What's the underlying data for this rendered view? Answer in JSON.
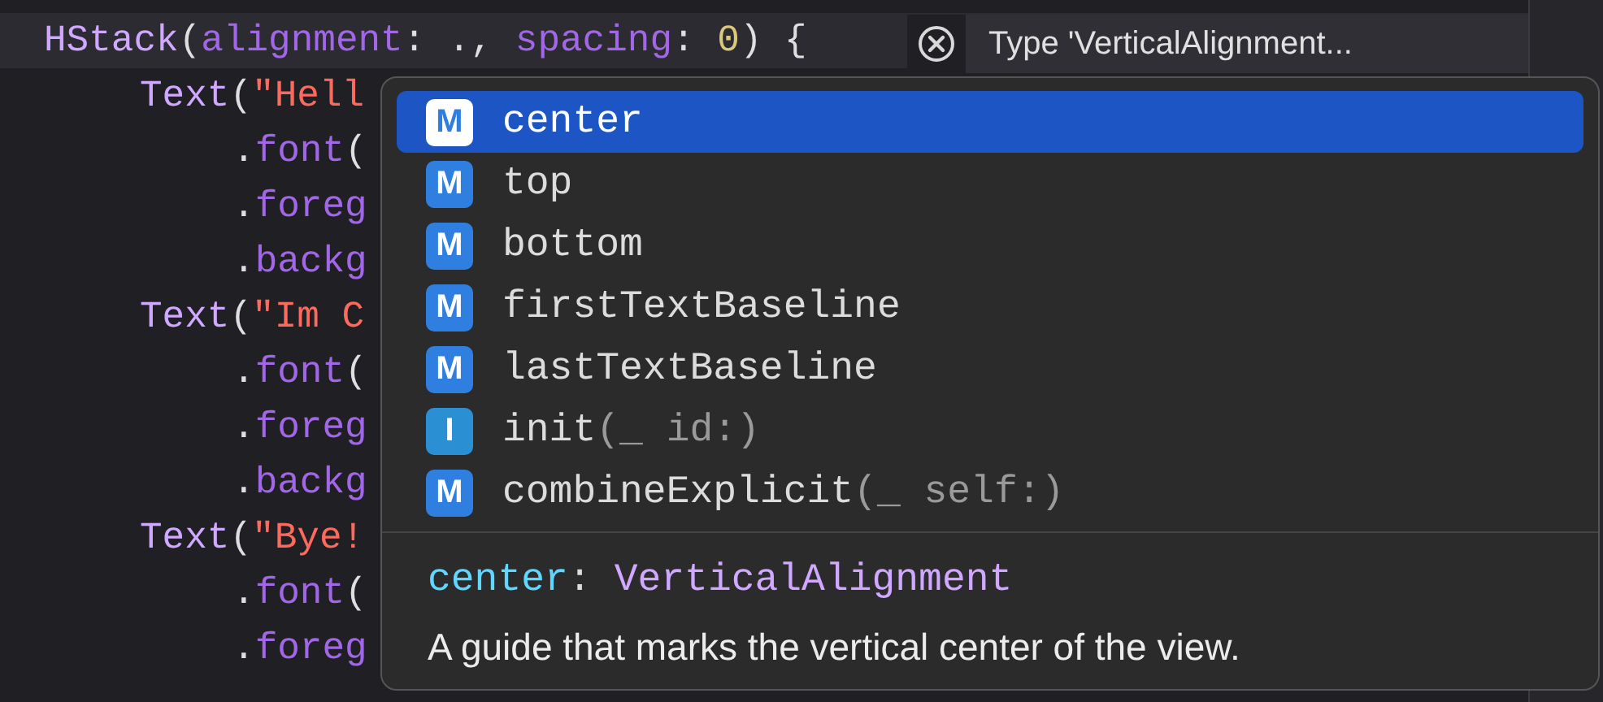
{
  "code_lines": [
    {
      "kind": "stack",
      "current": true,
      "tokens": [
        {
          "text": "HStack",
          "kind": "type"
        },
        {
          "text": "(",
          "kind": "plain"
        },
        {
          "text": "alignment",
          "kind": "member"
        },
        {
          "text": ": ., ",
          "kind": "plain"
        },
        {
          "text": "spacing",
          "kind": "member"
        },
        {
          "text": ": ",
          "kind": "plain"
        },
        {
          "text": "0",
          "kind": "number"
        },
        {
          "text": ") {",
          "kind": "plain"
        }
      ]
    },
    {
      "kind": "view",
      "current": false,
      "tokens": [
        {
          "text": "Text",
          "kind": "type"
        },
        {
          "text": "(",
          "kind": "plain"
        },
        {
          "text": "\"Hell",
          "kind": "string"
        }
      ]
    },
    {
      "kind": "modifier",
      "current": false,
      "tokens": [
        {
          "text": ".",
          "kind": "plain"
        },
        {
          "text": "font",
          "kind": "member"
        },
        {
          "text": "(",
          "kind": "plain"
        }
      ]
    },
    {
      "kind": "modifier",
      "current": false,
      "tokens": [
        {
          "text": ".",
          "kind": "plain"
        },
        {
          "text": "foreg",
          "kind": "member"
        }
      ]
    },
    {
      "kind": "modifier",
      "current": false,
      "tokens": [
        {
          "text": ".",
          "kind": "plain"
        },
        {
          "text": "backg",
          "kind": "member"
        }
      ]
    },
    {
      "kind": "view",
      "current": false,
      "tokens": [
        {
          "text": "Text",
          "kind": "type"
        },
        {
          "text": "(",
          "kind": "plain"
        },
        {
          "text": "\"Im C",
          "kind": "string"
        }
      ]
    },
    {
      "kind": "modifier",
      "current": false,
      "tokens": [
        {
          "text": ".",
          "kind": "plain"
        },
        {
          "text": "font",
          "kind": "member"
        },
        {
          "text": "(",
          "kind": "plain"
        }
      ]
    },
    {
      "kind": "modifier",
      "current": false,
      "tokens": [
        {
          "text": ".",
          "kind": "plain"
        },
        {
          "text": "foreg",
          "kind": "member"
        }
      ]
    },
    {
      "kind": "modifier",
      "current": false,
      "tokens": [
        {
          "text": ".",
          "kind": "plain"
        },
        {
          "text": "backg",
          "kind": "member"
        }
      ]
    },
    {
      "kind": "view",
      "current": false,
      "tokens": [
        {
          "text": "Text",
          "kind": "type"
        },
        {
          "text": "(",
          "kind": "plain"
        },
        {
          "text": "\"Bye!",
          "kind": "string"
        }
      ]
    },
    {
      "kind": "modifier",
      "current": false,
      "tokens": [
        {
          "text": ".",
          "kind": "plain"
        },
        {
          "text": "font",
          "kind": "member"
        },
        {
          "text": "(",
          "kind": "plain"
        }
      ]
    },
    {
      "kind": "modifier",
      "current": false,
      "tokens": [
        {
          "text": ".",
          "kind": "plain"
        },
        {
          "text": "foreg",
          "kind": "member"
        }
      ]
    }
  ],
  "error": {
    "message": "Type 'VerticalAlignment..."
  },
  "completions": [
    {
      "kind": "method",
      "badge": "M",
      "name": "center",
      "selected": true
    },
    {
      "kind": "method",
      "badge": "M",
      "name": "top",
      "selected": false
    },
    {
      "kind": "method",
      "badge": "M",
      "name": "bottom",
      "selected": false
    },
    {
      "kind": "method",
      "badge": "M",
      "name": "firstTextBaseline",
      "selected": false
    },
    {
      "kind": "method",
      "badge": "M",
      "name": "lastTextBaseline",
      "selected": false
    },
    {
      "kind": "initializer",
      "badge": "I",
      "name": "init",
      "signature": "(_ id:)",
      "selected": false
    },
    {
      "kind": "method",
      "badge": "M",
      "name": "combineExplicit",
      "signature": "(_ self:)",
      "selected": false
    }
  ],
  "detail": {
    "name": "center",
    "separator": ":",
    "type": "VerticalAlignment",
    "description": "A guide that marks the vertical center of the view."
  }
}
